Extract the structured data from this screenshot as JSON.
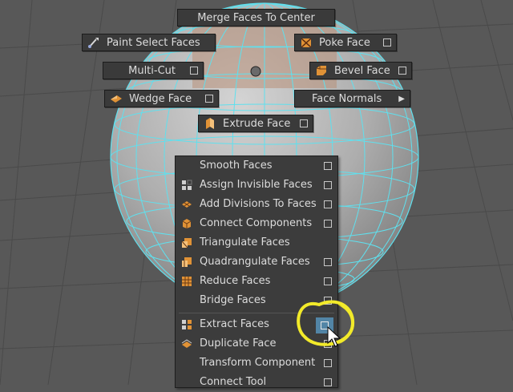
{
  "marking_menu": {
    "merge_faces": "Merge Faces To Center",
    "paint_select": "Paint Select Faces",
    "poke_face": "Poke Face",
    "multi_cut": "Multi-Cut",
    "bevel_face": "Bevel Face",
    "wedge_face": "Wedge Face",
    "face_normals": "Face Normals",
    "extrude_face": "Extrude Face"
  },
  "popup_items": [
    {
      "label": "Smooth Faces",
      "icon": "none",
      "has_options": true
    },
    {
      "label": "Assign Invisible Faces",
      "icon": "assign-invisible-icon",
      "has_options": true
    },
    {
      "label": "Add Divisions To Faces",
      "icon": "add-divisions-icon",
      "has_options": true
    },
    {
      "label": "Connect Components",
      "icon": "connect-components-icon",
      "has_options": true
    },
    {
      "label": "Triangulate Faces",
      "icon": "triangulate-icon",
      "has_options": false
    },
    {
      "label": "Quadrangulate Faces",
      "icon": "quadrangulate-icon",
      "has_options": true
    },
    {
      "label": "Reduce Faces",
      "icon": "reduce-icon",
      "has_options": true
    },
    {
      "label": "Bridge Faces",
      "icon": "none",
      "has_options": true
    },
    {
      "label": "Extract Faces",
      "icon": "extract-icon",
      "has_options": true,
      "highlighted": true
    },
    {
      "label": "Duplicate Face",
      "icon": "duplicate-icon",
      "has_options": true
    },
    {
      "label": "Transform Component",
      "icon": "none",
      "has_options": true
    },
    {
      "label": "Connect Tool",
      "icon": "none",
      "has_options": true
    }
  ],
  "colors": {
    "viewport_bg": "#585858",
    "wireframe": "#5fe0ee",
    "menu_bg": "#3a3a3a",
    "highlight": "#5285a6",
    "annotation": "#f2ea2a",
    "icon_orange": "#e09236"
  }
}
